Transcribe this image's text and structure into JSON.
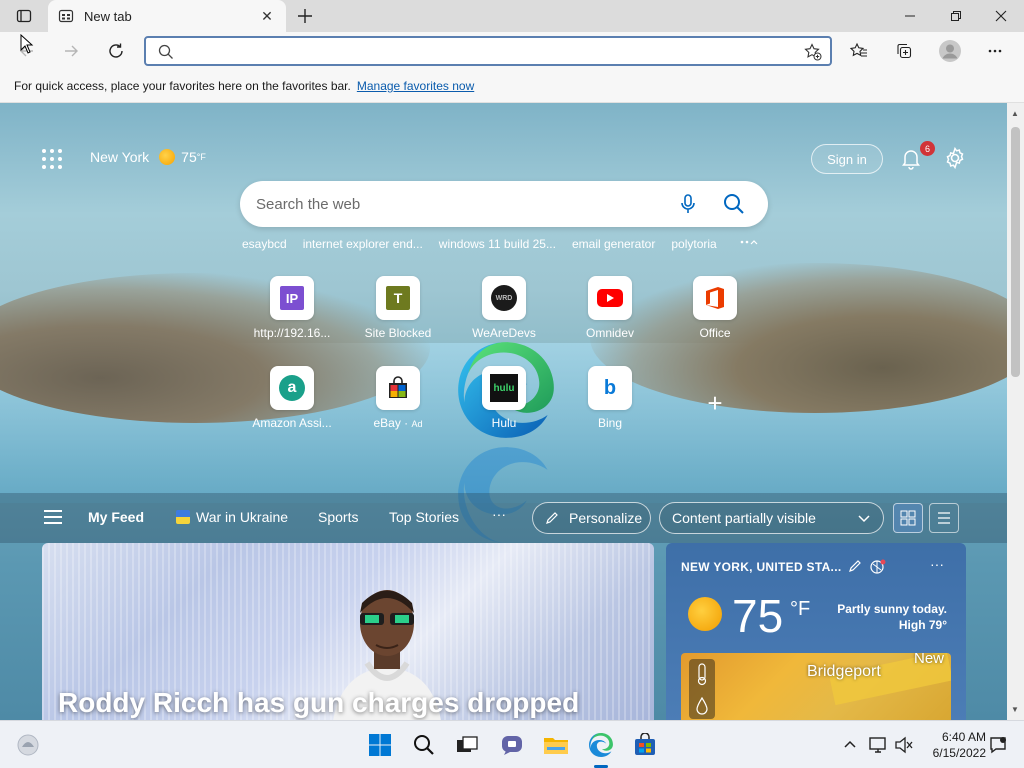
{
  "browser": {
    "tab": {
      "title": "New tab"
    },
    "favorites_bar": {
      "message": "For quick access, place your favorites here on the favorites bar.",
      "link": "Manage favorites now"
    }
  },
  "page": {
    "location": "New York",
    "temperature": "75",
    "temperature_unit": "°F",
    "sign_in": "Sign in",
    "notifications_count": "6",
    "search": {
      "placeholder": "Search the web",
      "suggestions": [
        "esaybcd",
        "internet explorer end...",
        "windows 11 build 25...",
        "email generator",
        "polytoria"
      ]
    },
    "shortcuts": [
      {
        "label": "http://192.16...",
        "icon": "ip-icon",
        "letter": "IP"
      },
      {
        "label": "Site Blocked",
        "icon": "site-blocked-icon",
        "letter": "T"
      },
      {
        "label": "WeAreDevs",
        "icon": "wearedevs-icon",
        "letter": "WRD"
      },
      {
        "label": "Omnidev",
        "icon": "youtube-icon"
      },
      {
        "label": "Office",
        "icon": "office-icon"
      },
      {
        "label": "Amazon Assi...",
        "icon": "amazon-icon",
        "letter": "a"
      },
      {
        "label": "eBay",
        "ad_label": "Ad",
        "icon": "ebay-icon"
      },
      {
        "label": "Hulu",
        "icon": "hulu-icon",
        "letter": "hulu"
      },
      {
        "label": "Bing",
        "icon": "bing-icon",
        "letter": "b"
      }
    ],
    "feed": {
      "tabs": [
        "My Feed",
        "War in Ukraine",
        "Sports",
        "Top Stories"
      ],
      "more": "···",
      "personalize": "Personalize",
      "content_visibility": "Content partially visible"
    },
    "news": {
      "headline": "Roddy Ricch has gun charges dropped"
    },
    "weather_card": {
      "location": "NEW YORK, UNITED STA...",
      "temperature": "75",
      "unit": "°F",
      "condition": "Partly sunny today.",
      "high": "High 79°",
      "map_city": "Bridgeport",
      "map_city2": "New"
    }
  },
  "taskbar": {
    "time": "6:40 AM",
    "date": "6/15/2022"
  },
  "colors": {
    "accent": "#0067c0",
    "link": "#0b5cad",
    "badge": "#d13438"
  }
}
